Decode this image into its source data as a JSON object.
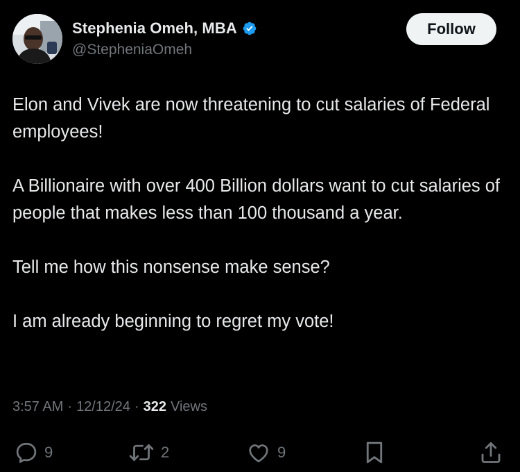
{
  "author": {
    "display_name": "Stephenia Omeh, MBA",
    "handle": "@StepheniaOmeh",
    "verified": true
  },
  "follow_button": {
    "label": "Follow"
  },
  "post": {
    "paragraphs": [
      "Elon and Vivek are now threatening to cut salaries of Federal employees!",
      "A Billionaire with over 400 Billion dollars want to cut salaries of people that makes less than 100 thousand a year.",
      "Tell me how this nonsense make sense?",
      "I am already beginning to regret my vote!"
    ],
    "time": "3:57 AM",
    "date": "12/12/24",
    "views_count": "322",
    "views_label": "Views",
    "separator": "·"
  },
  "actions": {
    "reply_count": "9",
    "repost_count": "2",
    "like_count": "9"
  },
  "icons": {
    "verified": "verified-badge-icon",
    "reply": "reply-icon",
    "repost": "repost-icon",
    "like": "heart-icon",
    "bookmark": "bookmark-icon",
    "share": "share-icon"
  },
  "colors": {
    "background": "#000000",
    "text_primary": "#e7e9ea",
    "text_secondary": "#71767b",
    "verified_blue": "#1d9bf0",
    "follow_bg": "#eff3f4"
  }
}
